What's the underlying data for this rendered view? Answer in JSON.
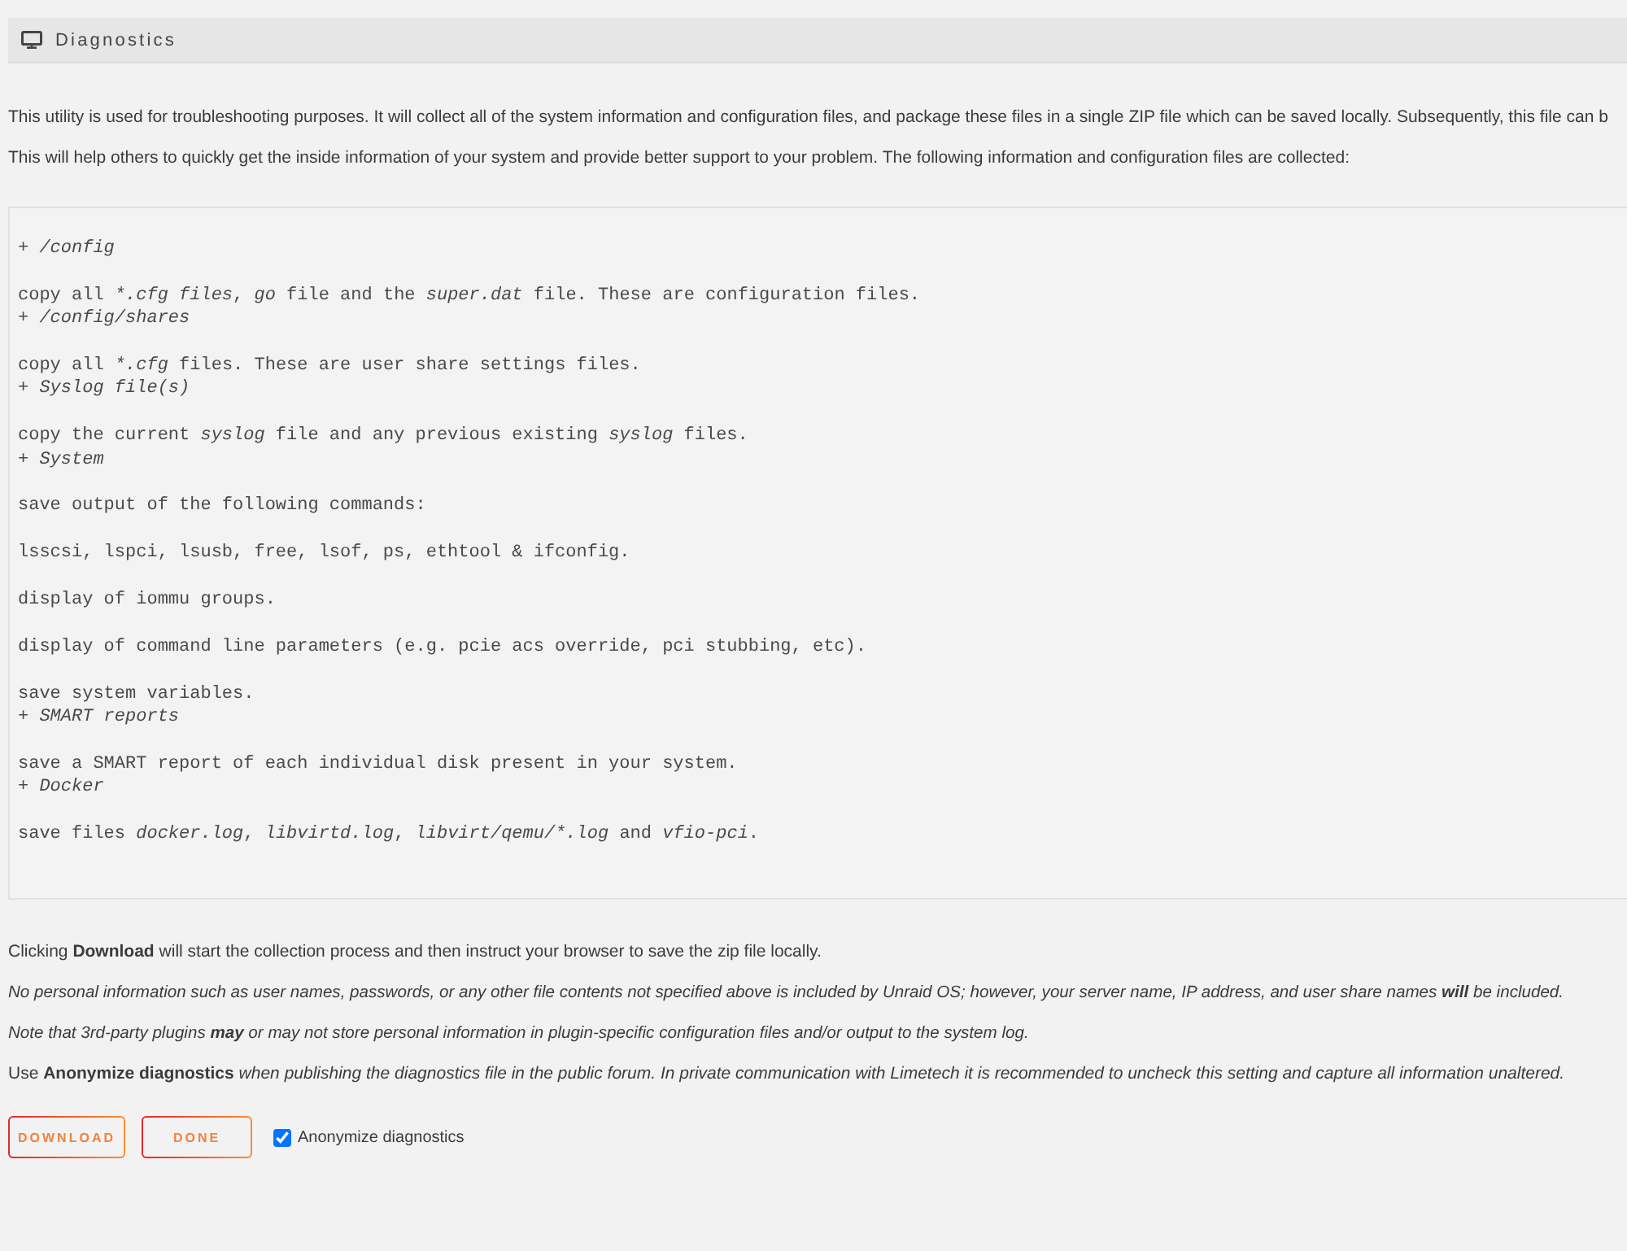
{
  "header": {
    "title": "Diagnostics"
  },
  "intro": [
    "This utility is used for troubleshooting purposes. It will collect all of the system information and configuration files, and package these files in a single ZIP file which can be saved locally. Subsequently, this file can b",
    "This will help others to quickly get the inside information of your system and provide better support to your problem. The following information and configuration files are collected:"
  ],
  "collected": [
    {
      "heading": "+ /config",
      "lines": [
        [
          {
            "text": "copy all ",
            "italic": false
          },
          {
            "text": "*.cfg files",
            "italic": true
          },
          {
            "text": ", ",
            "italic": false
          },
          {
            "text": "go",
            "italic": true
          },
          {
            "text": " file and the ",
            "italic": false
          },
          {
            "text": "super.dat",
            "italic": true
          },
          {
            "text": " file. These are configuration files.",
            "italic": false
          }
        ]
      ]
    },
    {
      "heading": "+ /config/shares",
      "lines": [
        [
          {
            "text": "copy all ",
            "italic": false
          },
          {
            "text": "*.cfg",
            "italic": true
          },
          {
            "text": " files. These are user share settings files.",
            "italic": false
          }
        ]
      ]
    },
    {
      "heading": "+ Syslog file(s)",
      "lines": [
        [
          {
            "text": "copy the current ",
            "italic": false
          },
          {
            "text": "syslog",
            "italic": true
          },
          {
            "text": " file and any previous existing ",
            "italic": false
          },
          {
            "text": "syslog",
            "italic": true
          },
          {
            "text": " files.",
            "italic": false
          }
        ]
      ]
    },
    {
      "heading": "+ System",
      "lines": [
        [
          {
            "text": "save output of the following commands:",
            "italic": false
          }
        ],
        [
          {
            "text": "lsscsi, lspci, lsusb, free, lsof, ps, ethtool & ifconfig.",
            "italic": false
          }
        ],
        [
          {
            "text": "display of iommu groups.",
            "italic": false
          }
        ],
        [
          {
            "text": "display of command line parameters (e.g. pcie acs override, pci stubbing, etc).",
            "italic": false
          }
        ],
        [
          {
            "text": "save system variables.",
            "italic": false
          }
        ]
      ]
    },
    {
      "heading": "+ SMART reports",
      "lines": [
        [
          {
            "text": "save a SMART report of each individual disk present in your system.",
            "italic": false
          }
        ]
      ]
    },
    {
      "heading": "+ Docker",
      "lines": [
        [
          {
            "text": "save files ",
            "italic": false
          },
          {
            "text": "docker.log",
            "italic": true
          },
          {
            "text": ", ",
            "italic": false
          },
          {
            "text": "libvirtd.log",
            "italic": true
          },
          {
            "text": ", ",
            "italic": false
          },
          {
            "text": "libvirt/qemu/*.log",
            "italic": true
          },
          {
            "text": " and ",
            "italic": false
          },
          {
            "text": "vfio-pci",
            "italic": true
          },
          {
            "text": ".",
            "italic": false
          }
        ]
      ]
    }
  ],
  "notes": [
    {
      "text": "Clicking **Download** will start the collection process and then instruct your browser to save the zip file locally.",
      "italic": false
    },
    {
      "text": "No personal information such as user names, passwords, or any other file contents not specified above is included by Unraid OS; however, your server name, IP address, and user share names **will** be included.",
      "italic": true
    },
    {
      "text": "Note that 3rd-party plugins **may** or may not store personal information in plugin-specific configuration files and/or output to the system log.",
      "italic": true
    },
    {
      "text": "Use **Anonymize diagnostics** *when publishing the diagnostics file in the public forum. In private communication with Limetech it is recommended to uncheck this setting and capture all information unaltered.*",
      "italic": false
    }
  ],
  "buttons": [
    {
      "label": "DOWNLOAD"
    },
    {
      "label": "DONE"
    }
  ],
  "option": {
    "label": "Anonymize diagnostics",
    "checked": true
  }
}
